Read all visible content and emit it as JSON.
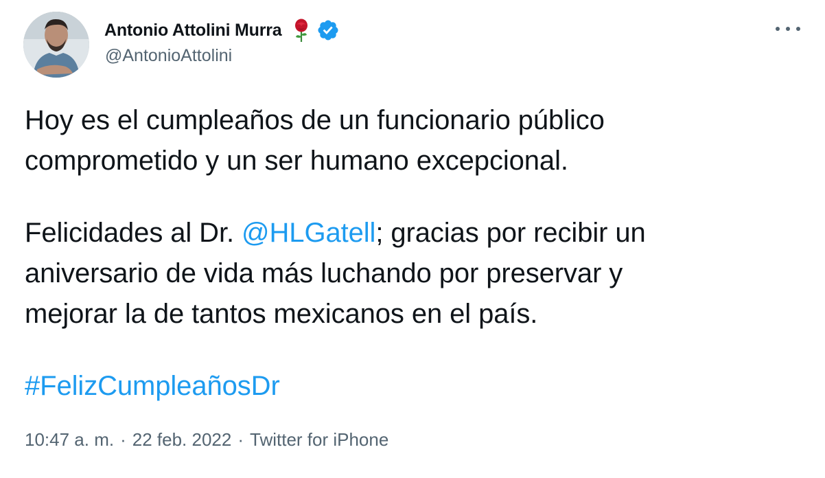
{
  "author": {
    "display_name": "Antonio Attolini Murra",
    "handle": "@AntonioAttolini",
    "emoji": "rose-icon",
    "verified": true
  },
  "tweet": {
    "line1": "Hoy es el cumpleaños de un funcionario público",
    "line2": "comprometido y un ser humano excepcional.",
    "line3_prefix": "Felicidades al Dr. ",
    "mention": "@HLGatell",
    "line3_suffix": "; gracias por recibir un",
    "line4": "aniversario de vida más luchando por preservar y",
    "line5": "mejorar la de tantos mexicanos en el país.",
    "hashtag": "#FelizCumpleañosDr"
  },
  "meta": {
    "time": "10:47 a. m.",
    "separator": "·",
    "date": "22 feb. 2022",
    "source": "Twitter for iPhone"
  },
  "colors": {
    "link": "#1d9bf0",
    "text": "#0f1419",
    "secondary": "#536471"
  }
}
